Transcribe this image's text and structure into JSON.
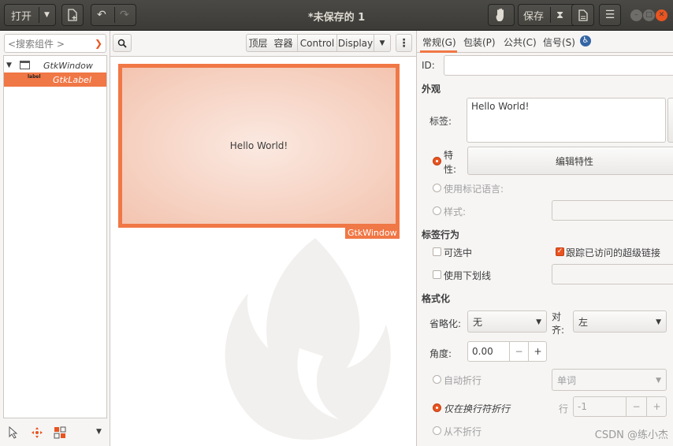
{
  "header": {
    "open_label": "打开",
    "title": "*未保存的 1",
    "save_label": "保存"
  },
  "left": {
    "search_placeholder": "<搜索组件 >",
    "tree": [
      {
        "label": "GtkWindow",
        "icon": "window-icon"
      },
      {
        "label": "GtkLabel",
        "icon": "label-icon",
        "icon_text": "label"
      }
    ]
  },
  "center": {
    "toolbar": [
      "顶层",
      "容器",
      "Control",
      "Display"
    ],
    "window_text": "Hello World!",
    "window_tag": "GtkWindow"
  },
  "right": {
    "tabs": [
      "常规(G)",
      "包装(P)",
      "公共(C)",
      "信号(S)"
    ],
    "id_label": "ID:",
    "appearance_section": "外观",
    "label_label": "标签:",
    "label_value": "Hello World!",
    "attributes_label": "特性:",
    "edit_attributes_button": "编辑特性",
    "use_markup_label": "使用标记语言:",
    "style_label": "样式:",
    "label_behavior_section": "标签行为",
    "selectable_label": "可选中",
    "track_links_label": "跟踪已访问的超级链接",
    "use_underline_label": "使用下划线",
    "formatting_section": "格式化",
    "ellipsize_label": "省略化:",
    "ellipsize_value": "无",
    "justify_label": "对齐:",
    "justify_value": "左",
    "angle_label": "角度:",
    "angle_value": "0.00",
    "auto_wrap_label": "自动折行",
    "wrap_mode_value": "单词",
    "newline_wrap_label": "仅在换行符折行",
    "lines_label": "行",
    "lines_value": "-1",
    "no_wrap_label": "从不折行"
  },
  "watermark": "CSDN @练小杰",
  "colors": {
    "accent": "#f07746",
    "ubuntu_orange": "#e95420",
    "headerbar": "#3c3b37"
  }
}
